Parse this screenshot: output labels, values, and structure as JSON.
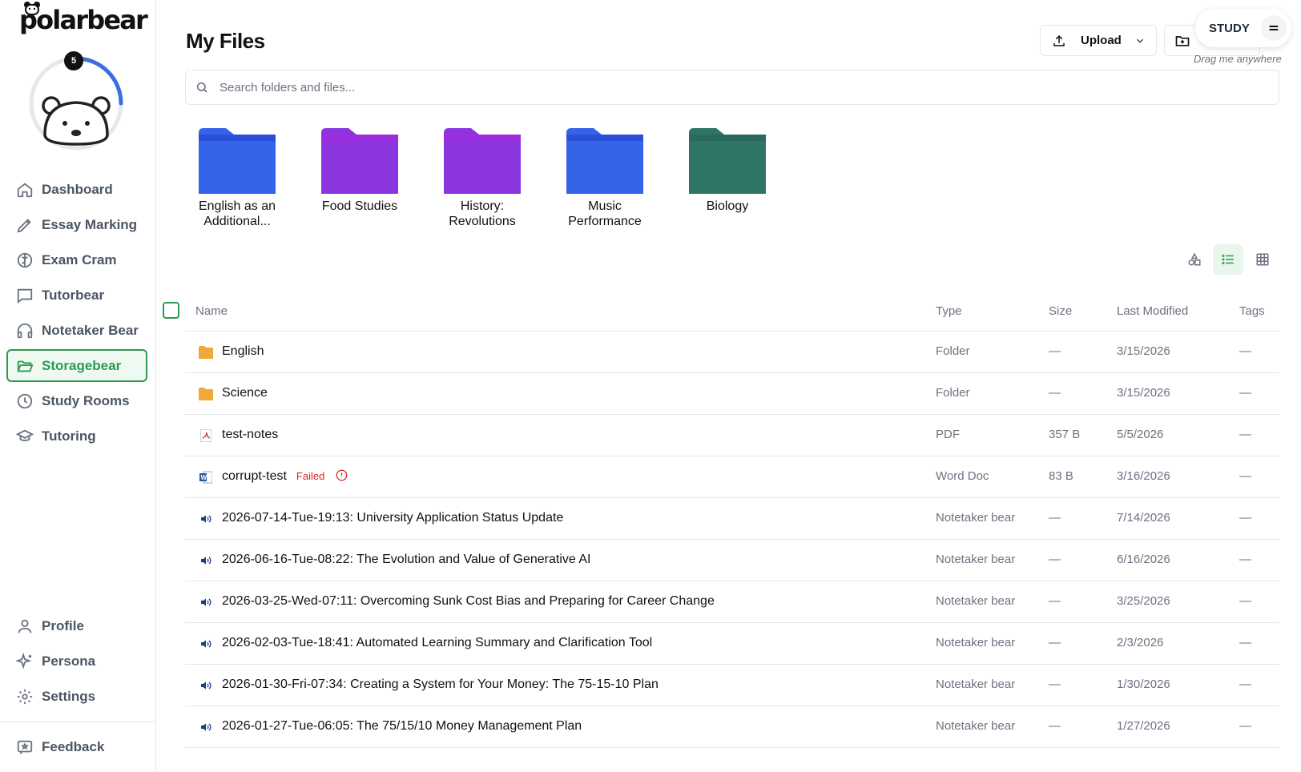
{
  "brand": {
    "name": "polarbear"
  },
  "avatar": {
    "badge": "5",
    "progress": 0.25
  },
  "sidebar": {
    "items": [
      {
        "label": "Dashboard",
        "icon": "home-icon"
      },
      {
        "label": "Essay Marking",
        "icon": "pen-icon"
      },
      {
        "label": "Exam Cram",
        "icon": "brain-icon"
      },
      {
        "label": "Tutorbear",
        "icon": "chat-icon"
      },
      {
        "label": "Notetaker Bear",
        "icon": "headphones-icon"
      },
      {
        "label": "Storagebear",
        "icon": "folder-open-icon",
        "active": true
      },
      {
        "label": "Study Rooms",
        "icon": "clock-icon"
      },
      {
        "label": "Tutoring",
        "icon": "graduation-cap-icon"
      }
    ],
    "bottom": [
      {
        "label": "Profile",
        "icon": "user-icon"
      },
      {
        "label": "Persona",
        "icon": "sparkles-icon"
      },
      {
        "label": "Settings",
        "icon": "gear-icon"
      }
    ],
    "feedback": {
      "label": "Feedback",
      "icon": "feedback-icon"
    }
  },
  "header": {
    "title": "My Files",
    "upload_label": "Upload",
    "study_label": "STUDY",
    "drag_hint": "Drag me anywhere"
  },
  "search": {
    "placeholder": "Search folders and files..."
  },
  "folders": [
    {
      "label": "English as an Additional...",
      "color": "#3563e9"
    },
    {
      "label": "Food Studies",
      "color": "#8b35e0"
    },
    {
      "label": "History: Revolutions",
      "color": "#8b35e0"
    },
    {
      "label": "Music Performance",
      "color": "#3563e9"
    },
    {
      "label": "Biology",
      "color": "#2f7567"
    }
  ],
  "table": {
    "headers": {
      "name": "Name",
      "type": "Type",
      "size": "Size",
      "modified": "Last Modified",
      "tags": "Tags"
    },
    "rows": [
      {
        "icon": "folder-icon",
        "name": "English",
        "type": "Folder",
        "size": "—",
        "modified": "3/15/2026",
        "tags": "—"
      },
      {
        "icon": "folder-icon",
        "name": "Science",
        "type": "Folder",
        "size": "—",
        "modified": "3/15/2026",
        "tags": "—"
      },
      {
        "icon": "pdf-icon",
        "name": "test-notes",
        "type": "PDF",
        "size": "357 B",
        "modified": "5/5/2026",
        "tags": "—"
      },
      {
        "icon": "word-icon",
        "name": "corrupt-test",
        "status": "Failed",
        "type": "Word Doc",
        "size": "83 B",
        "modified": "3/16/2026",
        "tags": "—"
      },
      {
        "icon": "speaker-icon",
        "name": "2026-07-14-Tue-19:13: University Application Status Update",
        "type": "Notetaker bear",
        "size": "—",
        "modified": "7/14/2026",
        "tags": "—"
      },
      {
        "icon": "speaker-icon",
        "name": "2026-06-16-Tue-08:22: The Evolution and Value of Generative AI",
        "type": "Notetaker bear",
        "size": "—",
        "modified": "6/16/2026",
        "tags": "—"
      },
      {
        "icon": "speaker-icon",
        "name": "2026-03-25-Wed-07:11: Overcoming Sunk Cost Bias and Preparing for Career Change",
        "type": "Notetaker bear",
        "size": "—",
        "modified": "3/25/2026",
        "tags": "—"
      },
      {
        "icon": "speaker-icon",
        "name": "2026-02-03-Tue-18:41: Automated Learning Summary and Clarification Tool",
        "type": "Notetaker bear",
        "size": "—",
        "modified": "2/3/2026",
        "tags": "—"
      },
      {
        "icon": "speaker-icon",
        "name": "2026-01-30-Fri-07:34: Creating a System for Your Money: The 75-15-10 Plan",
        "type": "Notetaker bear",
        "size": "—",
        "modified": "1/30/2026",
        "tags": "—"
      },
      {
        "icon": "speaker-icon",
        "name": "2026-01-27-Tue-06:05: The 75/15/10 Money Management Plan",
        "type": "Notetaker bear",
        "size": "—",
        "modified": "1/27/2026",
        "tags": "—"
      }
    ]
  },
  "colors": {
    "accent": "#2e9a4f",
    "failed": "#dc2626",
    "folder_row": "#f0a938"
  }
}
